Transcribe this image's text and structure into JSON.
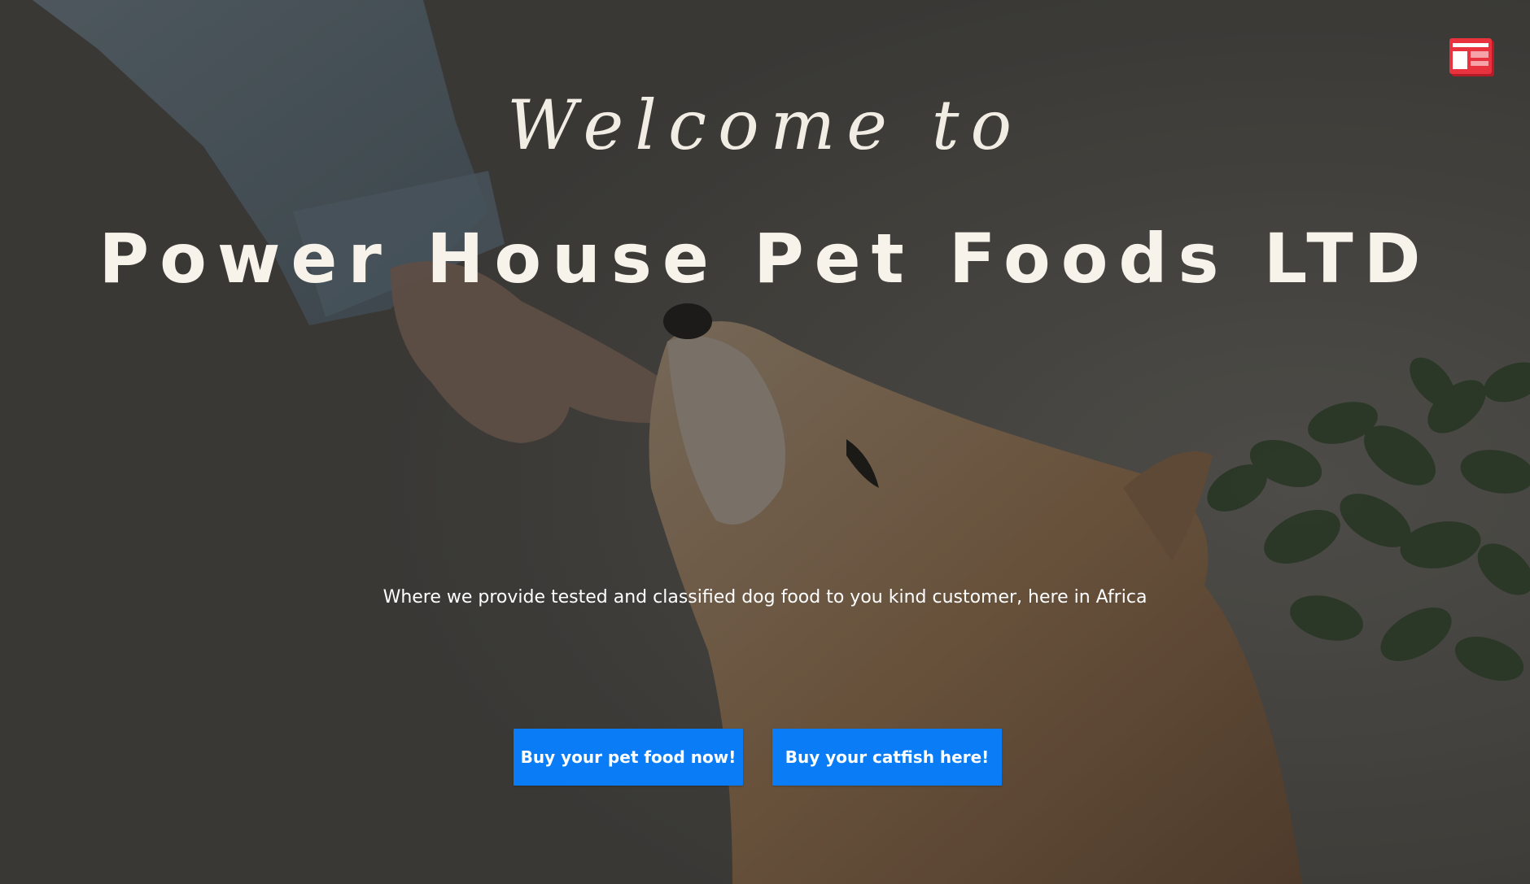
{
  "hero": {
    "welcome_text": "Welcome to",
    "brand_title": "Power House Pet Foods LTD",
    "tagline": "Where we provide tested and classified dog food to you kind customer, here in Africa",
    "buttons": [
      {
        "label": "Buy your pet food now!"
      },
      {
        "label": "Buy your catfish here!"
      }
    ]
  },
  "icons": {
    "corner_widget": "layout-widget-icon"
  },
  "colors": {
    "button_bg": "#0a7cf5",
    "button_text": "#ffffff",
    "heading_text": "#f7f3ea",
    "widget_icon": "#e8333f"
  }
}
